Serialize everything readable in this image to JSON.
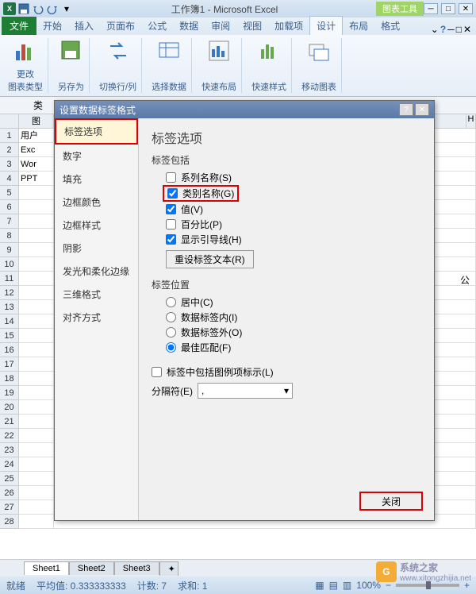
{
  "titlebar": {
    "doc_title": "工作簿1 - Microsoft Excel",
    "contextual": "图表工具"
  },
  "tabs": {
    "file": "文件",
    "items": [
      "开始",
      "插入",
      "页面布",
      "公式",
      "数据",
      "审阅",
      "视图",
      "加载项",
      "设计",
      "布局",
      "格式"
    ]
  },
  "ribbon": {
    "g1": "更改\n图表类型",
    "g2": "另存为",
    "g3": "切换行/列",
    "g4": "选择数据",
    "g5": "快速布局",
    "g6": "快速样式",
    "g7": "移动图表"
  },
  "formula": {
    "name_box_label": "类"
  },
  "grid": {
    "cols": [
      "图",
      "",
      "",
      "",
      "",
      "",
      "",
      "",
      "H"
    ],
    "rows": [
      {
        "n": "1",
        "a": "用户"
      },
      {
        "n": "2",
        "a": "Exc"
      },
      {
        "n": "3",
        "a": "Wor"
      },
      {
        "n": "4",
        "a": "PPT"
      },
      {
        "n": "5",
        "a": ""
      },
      {
        "n": "6",
        "a": ""
      },
      {
        "n": "7",
        "a": ""
      },
      {
        "n": "8",
        "a": ""
      },
      {
        "n": "9",
        "a": ""
      },
      {
        "n": "10",
        "a": ""
      },
      {
        "n": "11",
        "a": ""
      },
      {
        "n": "12",
        "a": ""
      },
      {
        "n": "13",
        "a": ""
      },
      {
        "n": "14",
        "a": ""
      },
      {
        "n": "15",
        "a": ""
      },
      {
        "n": "16",
        "a": ""
      },
      {
        "n": "17",
        "a": ""
      },
      {
        "n": "18",
        "a": ""
      },
      {
        "n": "19",
        "a": ""
      },
      {
        "n": "20",
        "a": ""
      },
      {
        "n": "21",
        "a": ""
      },
      {
        "n": "22",
        "a": ""
      },
      {
        "n": "23",
        "a": ""
      },
      {
        "n": "24",
        "a": ""
      },
      {
        "n": "25",
        "a": ""
      },
      {
        "n": "26",
        "a": ""
      },
      {
        "n": "27",
        "a": ""
      },
      {
        "n": "28",
        "a": ""
      }
    ],
    "extra_text": "公"
  },
  "dialog": {
    "title": "设置数据标签格式",
    "sidebar": [
      "标签选项",
      "数字",
      "填充",
      "边框颜色",
      "边框样式",
      "阴影",
      "发光和柔化边缘",
      "三维格式",
      "对齐方式"
    ],
    "heading": "标签选项",
    "includes_label": "标签包括",
    "chk_series": "系列名称(S)",
    "chk_category": "类别名称(G)",
    "chk_value": "值(V)",
    "chk_percent": "百分比(P)",
    "chk_leader": "显示引导线(H)",
    "reset_btn": "重设标签文本(R)",
    "position_label": "标签位置",
    "radio_center": "居中(C)",
    "radio_inside": "数据标签内(I)",
    "radio_outside": "数据标签外(O)",
    "radio_bestfit": "最佳匹配(F)",
    "chk_legend": "标签中包括图例项标示(L)",
    "separator_label": "分隔符(E)",
    "separator_value": ",",
    "close": "关闭"
  },
  "sheets": {
    "s1": "Sheet1",
    "s2": "Sheet2",
    "s3": "Sheet3"
  },
  "status": {
    "ready": "就绪",
    "avg": "平均值: 0.333333333",
    "count": "计数: 7",
    "sum": "求和: 1",
    "zoom": "100%"
  },
  "watermark": {
    "text": "系统之家",
    "url": "www.xitongzhijia.net"
  }
}
